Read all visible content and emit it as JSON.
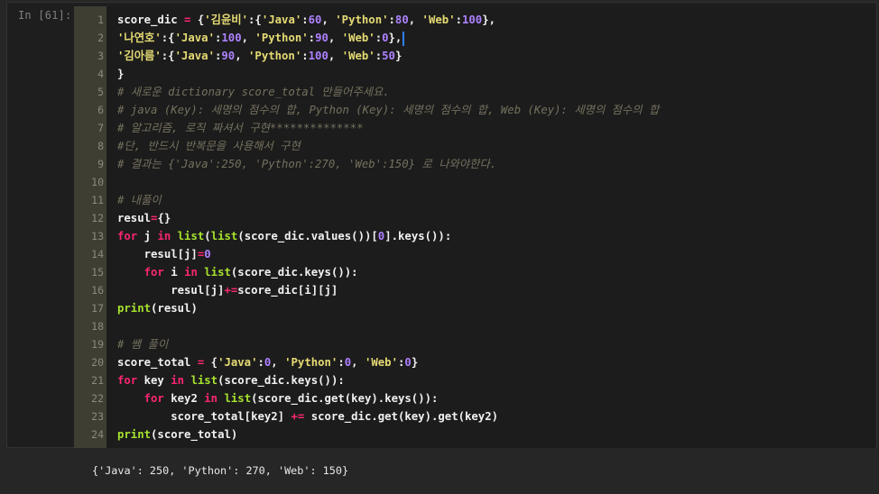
{
  "cell": {
    "prompt": "In [61]:",
    "lines": [
      {
        "n": "1",
        "segs": [
          [
            "score_dic ",
            "p"
          ],
          [
            "= ",
            "op"
          ],
          [
            "{",
            "p"
          ],
          [
            "'김윤비'",
            "str"
          ],
          [
            ":{",
            "p"
          ],
          [
            "'Java'",
            "str"
          ],
          [
            ":",
            "p"
          ],
          [
            "60",
            "num"
          ],
          [
            ", ",
            "p"
          ],
          [
            "'Python'",
            "str"
          ],
          [
            ":",
            "p"
          ],
          [
            "80",
            "num"
          ],
          [
            ", ",
            "p"
          ],
          [
            "'Web'",
            "str"
          ],
          [
            ":",
            "p"
          ],
          [
            "100",
            "num"
          ],
          [
            "},",
            "p"
          ]
        ]
      },
      {
        "n": "2",
        "segs": [
          [
            "'나연호'",
            "str"
          ],
          [
            ":{",
            "p"
          ],
          [
            "'Java'",
            "str"
          ],
          [
            ":",
            "p"
          ],
          [
            "100",
            "num"
          ],
          [
            ", ",
            "p"
          ],
          [
            "'Python'",
            "str"
          ],
          [
            ":",
            "p"
          ],
          [
            "90",
            "num"
          ],
          [
            ", ",
            "p"
          ],
          [
            "'Web'",
            "str"
          ],
          [
            ":",
            "p"
          ],
          [
            "0",
            "num"
          ],
          [
            "},",
            "p"
          ]
        ],
        "cursor": true
      },
      {
        "n": "3",
        "segs": [
          [
            "'김아름'",
            "str"
          ],
          [
            ":{",
            "p"
          ],
          [
            "'Java'",
            "str"
          ],
          [
            ":",
            "p"
          ],
          [
            "90",
            "num"
          ],
          [
            ", ",
            "p"
          ],
          [
            "'Python'",
            "str"
          ],
          [
            ":",
            "p"
          ],
          [
            "100",
            "num"
          ],
          [
            ", ",
            "p"
          ],
          [
            "'Web'",
            "str"
          ],
          [
            ":",
            "p"
          ],
          [
            "50",
            "num"
          ],
          [
            "}",
            "p"
          ]
        ]
      },
      {
        "n": "4",
        "segs": [
          [
            "}",
            "p"
          ]
        ]
      },
      {
        "n": "5",
        "comment": "# 새로운 dictionary score_total 만들어주세요."
      },
      {
        "n": "6",
        "comment": "# java (Key): 세명의 점수의 합, Python (Key): 세명의 점수의 합, Web (Key): 세명의 점수의 합"
      },
      {
        "n": "7",
        "comment": "# 알고리즘, 로직 짜셔서 구현**************"
      },
      {
        "n": "8",
        "comment": "#단, 반드시 반복문을 사용해서 구현"
      },
      {
        "n": "9",
        "comment": "# 결과는 {'Java':250, 'Python':270, 'Web':150} 로 나와야한다."
      },
      {
        "n": "10",
        "segs": []
      },
      {
        "n": "11",
        "comment": "# 내풀이"
      },
      {
        "n": "12",
        "segs": [
          [
            "resul",
            "p"
          ],
          [
            "=",
            "op"
          ],
          [
            "{}",
            "p"
          ]
        ]
      },
      {
        "n": "13",
        "segs": [
          [
            "for ",
            "kw"
          ],
          [
            "j ",
            "p"
          ],
          [
            "in ",
            "kw"
          ],
          [
            "list",
            "bi"
          ],
          [
            "(",
            "p"
          ],
          [
            "list",
            "bi"
          ],
          [
            "(score_dic.values())[",
            "p"
          ],
          [
            "0",
            "num"
          ],
          [
            "].keys()):",
            "p"
          ]
        ]
      },
      {
        "n": "14",
        "segs": [
          [
            "    resul[j]",
            "p"
          ],
          [
            "=",
            "op"
          ],
          [
            "0",
            "num"
          ]
        ]
      },
      {
        "n": "15",
        "segs": [
          [
            "    ",
            "p"
          ],
          [
            "for ",
            "kw"
          ],
          [
            "i ",
            "p"
          ],
          [
            "in ",
            "kw"
          ],
          [
            "list",
            "bi"
          ],
          [
            "(score_dic.keys()):",
            "p"
          ]
        ]
      },
      {
        "n": "16",
        "segs": [
          [
            "        resul[j]",
            "p"
          ],
          [
            "+=",
            "op"
          ],
          [
            "score_dic[i][j]",
            "p"
          ]
        ]
      },
      {
        "n": "17",
        "segs": [
          [
            "print",
            "bi"
          ],
          [
            "(resul)",
            "p"
          ]
        ]
      },
      {
        "n": "18",
        "segs": []
      },
      {
        "n": "19",
        "comment": "# 쌤 풀이"
      },
      {
        "n": "20",
        "segs": [
          [
            "score_total ",
            "p"
          ],
          [
            "= ",
            "op"
          ],
          [
            "{",
            "p"
          ],
          [
            "'Java'",
            "str"
          ],
          [
            ":",
            "p"
          ],
          [
            "0",
            "num"
          ],
          [
            ", ",
            "p"
          ],
          [
            "'Python'",
            "str"
          ],
          [
            ":",
            "p"
          ],
          [
            "0",
            "num"
          ],
          [
            ", ",
            "p"
          ],
          [
            "'Web'",
            "str"
          ],
          [
            ":",
            "p"
          ],
          [
            "0",
            "num"
          ],
          [
            "}",
            "p"
          ]
        ]
      },
      {
        "n": "21",
        "segs": [
          [
            "for ",
            "kw"
          ],
          [
            "key ",
            "p"
          ],
          [
            "in ",
            "kw"
          ],
          [
            "list",
            "bi"
          ],
          [
            "(score_dic.keys()):",
            "p"
          ]
        ]
      },
      {
        "n": "22",
        "segs": [
          [
            "    ",
            "p"
          ],
          [
            "for ",
            "kw"
          ],
          [
            "key2 ",
            "p"
          ],
          [
            "in ",
            "kw"
          ],
          [
            "list",
            "bi"
          ],
          [
            "(score_dic.get(key).keys()):",
            "p"
          ]
        ]
      },
      {
        "n": "23",
        "segs": [
          [
            "        score_total[key2] ",
            "p"
          ],
          [
            "+= ",
            "op"
          ],
          [
            "score_dic.get(key).get(key2)",
            "p"
          ]
        ]
      },
      {
        "n": "24",
        "segs": [
          [
            "print",
            "bi"
          ],
          [
            "(score_total)",
            "p"
          ]
        ]
      }
    ]
  },
  "output": {
    "text": "{'Java': 250, 'Python': 270, 'Web': 150}"
  }
}
